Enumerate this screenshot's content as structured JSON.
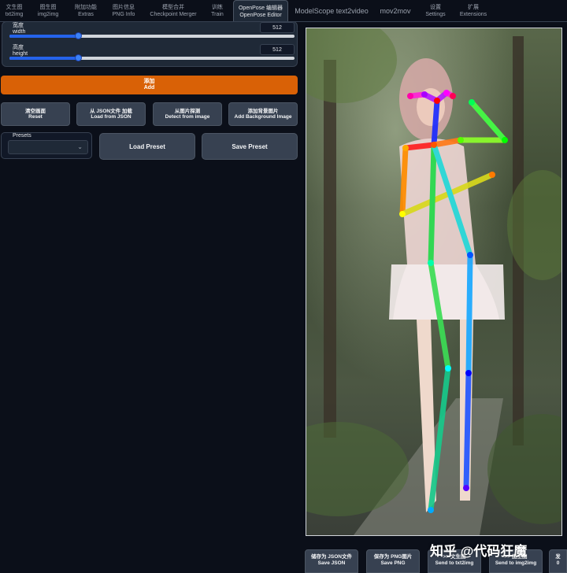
{
  "tabs": [
    {
      "cn": "文生图",
      "en": "txt2img"
    },
    {
      "cn": "图生图",
      "en": "img2img"
    },
    {
      "cn": "附加功能",
      "en": "Extras"
    },
    {
      "cn": "图片信息",
      "en": "PNG Info"
    },
    {
      "cn": "模型合并",
      "en": "Checkpoint Merger"
    },
    {
      "cn": "训练",
      "en": "Train"
    },
    {
      "cn": "OpenPose 编辑器",
      "en": "OpenPose Editor"
    },
    {
      "label": "ModelScope text2video"
    },
    {
      "label": "mov2mov"
    },
    {
      "cn": "设置",
      "en": "Settings"
    },
    {
      "cn": "扩展",
      "en": "Extensions"
    }
  ],
  "active_tab": "OpenPose Editor",
  "width_slider": {
    "cn": "宽度",
    "en": "width",
    "value": "512",
    "fraction": 0.24
  },
  "height_slider": {
    "cn": "高度",
    "en": "height",
    "value": "512",
    "fraction": 0.24
  },
  "add_button": {
    "cn": "添加",
    "en": "Add"
  },
  "actions": [
    {
      "cn": "清空画面",
      "en": "Reset"
    },
    {
      "cn": "从 JSON文件 加载",
      "en": "Load from JSON"
    },
    {
      "cn": "从图片探测",
      "en": "Detect from image"
    },
    {
      "cn": "添加背景图片",
      "en": "Add Background Image"
    }
  ],
  "presets": {
    "label": "Presets",
    "selected": ""
  },
  "load_preset": "Load Preset",
  "save_preset": "Save Preset",
  "bottom_buttons": [
    {
      "cn": "储存为 JSON文件",
      "en": "Save JSON"
    },
    {
      "cn": "保存为 PNG图片",
      "en": "Save PNG"
    },
    {
      "cn": ">> 文生图",
      "en": "Send to txt2img"
    },
    {
      "cn": ">> 图生图",
      "en": "Send to img2img"
    },
    {
      "cn": "发",
      "en": "0"
    }
  ],
  "watermark": "知乎 @代码狂魔",
  "colors": {
    "accent": "#d96106",
    "slider": "#2563eb",
    "background": "#0b0f19",
    "panel": "#1f2937"
  }
}
